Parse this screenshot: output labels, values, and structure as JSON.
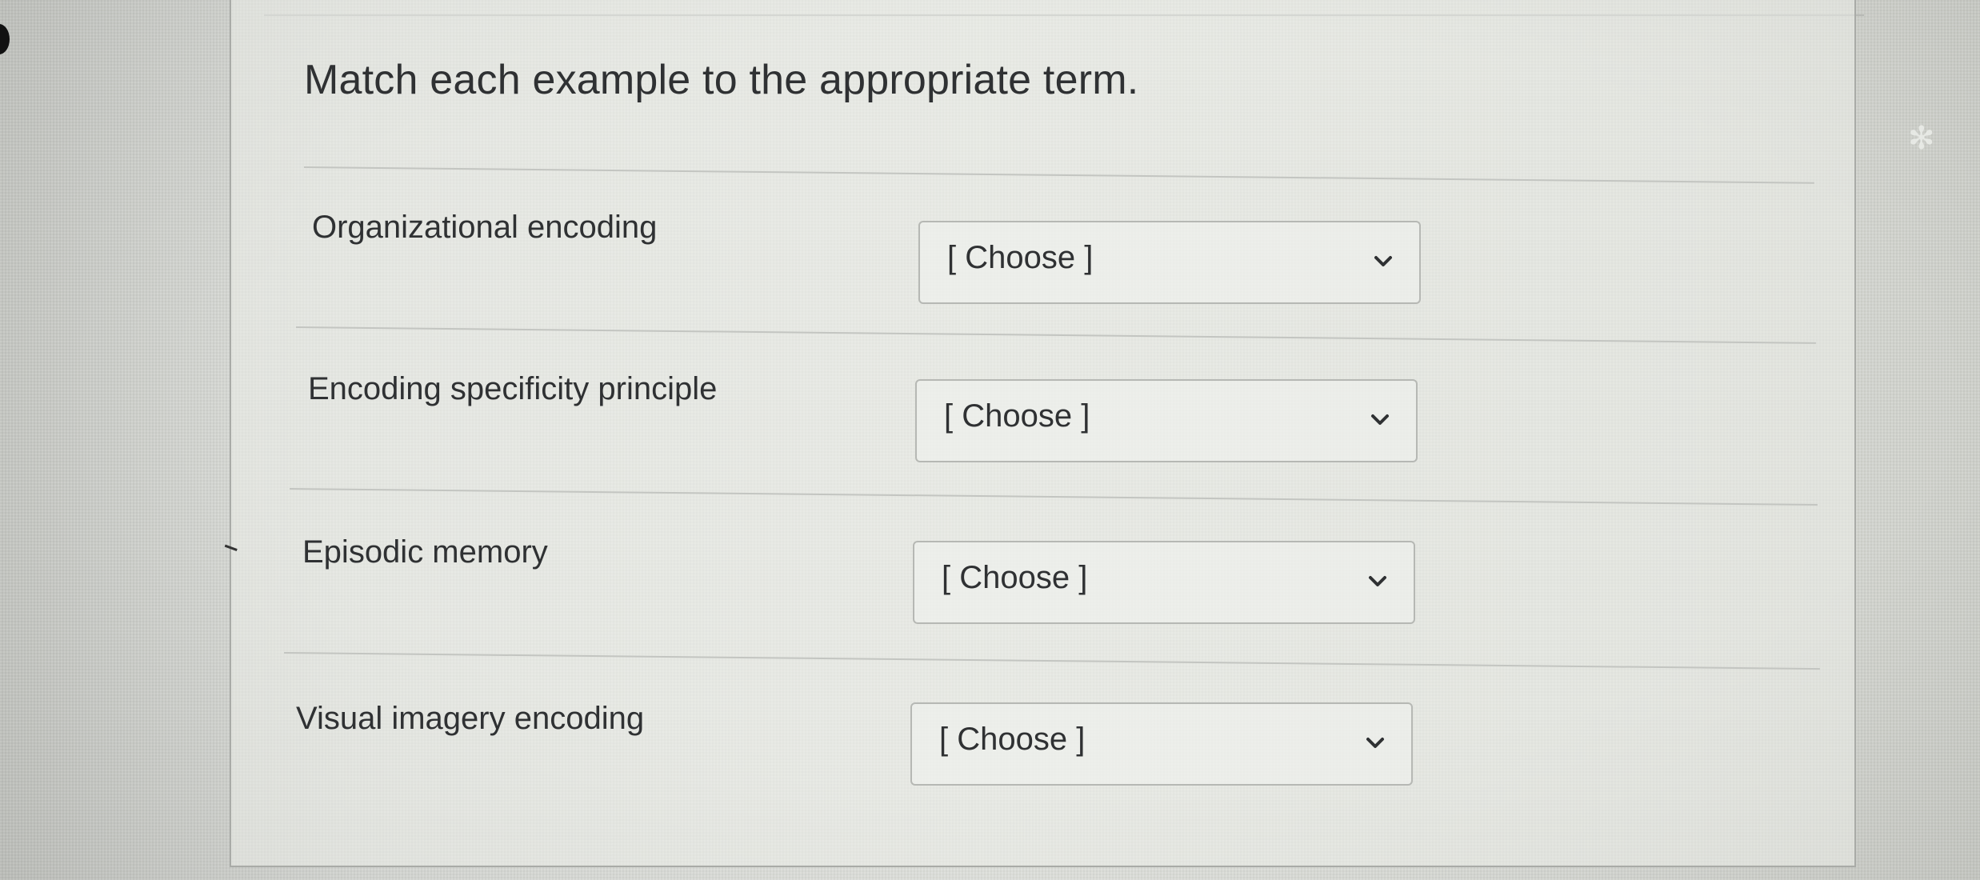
{
  "question": {
    "prompt": "Match each example to the appropriate term."
  },
  "rows": [
    {
      "term": "Organizational encoding",
      "select_value": "[ Choose ]"
    },
    {
      "term": "Encoding specificity principle",
      "select_value": "[ Choose ]"
    },
    {
      "term": "Episodic memory",
      "select_value": "[ Choose ]"
    },
    {
      "term": "Visual imagery encoding",
      "select_value": "[ Choose ]"
    }
  ],
  "icons": {
    "dropdown": "chevron-down-icon"
  },
  "colors": {
    "text": "#2f3133",
    "border": "#b6b8b4",
    "background": "#dcdeda"
  }
}
